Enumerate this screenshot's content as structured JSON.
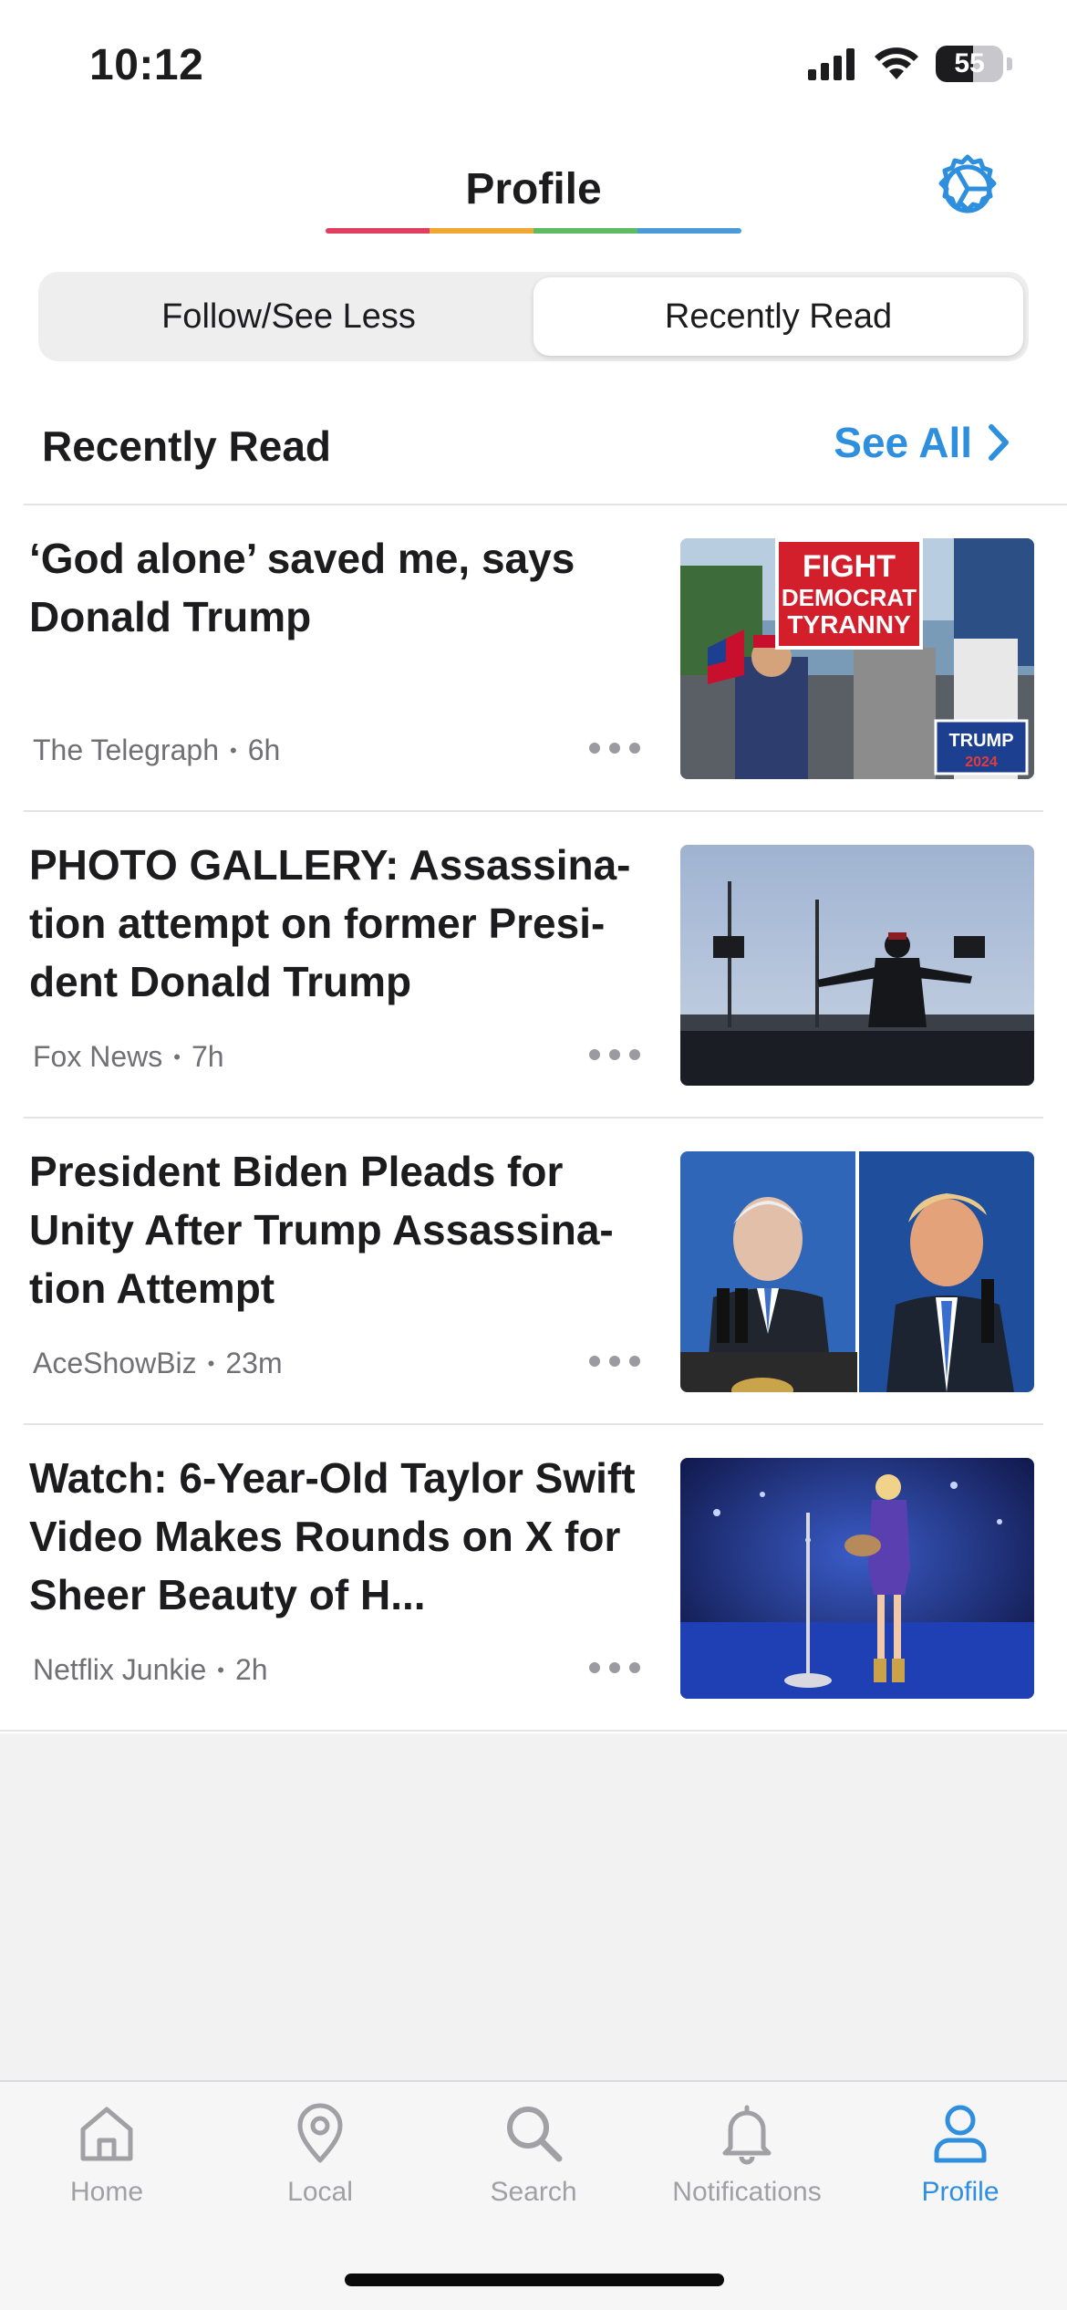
{
  "status_bar": {
    "time": "10:12",
    "battery_level": "55",
    "battery_fraction": 0.55
  },
  "header": {
    "title": "Profile",
    "underline_colors": [
      "#e0405f",
      "#f0a733",
      "#5dbb63",
      "#4a9bd8"
    ]
  },
  "segmented": {
    "options": [
      "Follow/See Less",
      "Recently Read"
    ],
    "selected": "Recently Read"
  },
  "section": {
    "title": "Recently Read",
    "see_all_label": "See All"
  },
  "articles": [
    {
      "headline": "‘God alone’ saved me, says Donald Trump",
      "source": "The Telegraph",
      "age": "6h",
      "image": "campaign-rally-protest-photo",
      "image_sign_text": "FIGHT DEMOCRAT TYRANNY",
      "image_sign2_text": "TRUMP 2024"
    },
    {
      "headline": "PHOTO GALLERY: Assassina-tion attempt on former Presi-dent Donald Trump",
      "source": "Fox News",
      "age": "7h",
      "image": "rally-stage-silhouette-photo"
    },
    {
      "headline": "President Biden Pleads for Unity After Trump Assassina-tion Attempt",
      "source": "AceShowBiz",
      "age": "23m",
      "image": "biden-trump-split-photo"
    },
    {
      "headline": "Watch: 6-Year-Old Taylor Swift Video Makes Rounds on X for Sheer Beauty of H...",
      "source": "Netflix Junkie",
      "age": "2h",
      "image": "singer-on-stage-photo"
    }
  ],
  "tab_bar": {
    "tabs": [
      {
        "label": "Home",
        "icon": "home-icon"
      },
      {
        "label": "Local",
        "icon": "map-pin-icon"
      },
      {
        "label": "Search",
        "icon": "search-icon"
      },
      {
        "label": "Notifications",
        "icon": "bell-icon"
      },
      {
        "label": "Profile",
        "icon": "person-icon"
      }
    ],
    "selected": "Profile"
  },
  "colors": {
    "accent": "#2f8fdf",
    "text": "#1c1c1e",
    "secondary_text": "#707075"
  }
}
